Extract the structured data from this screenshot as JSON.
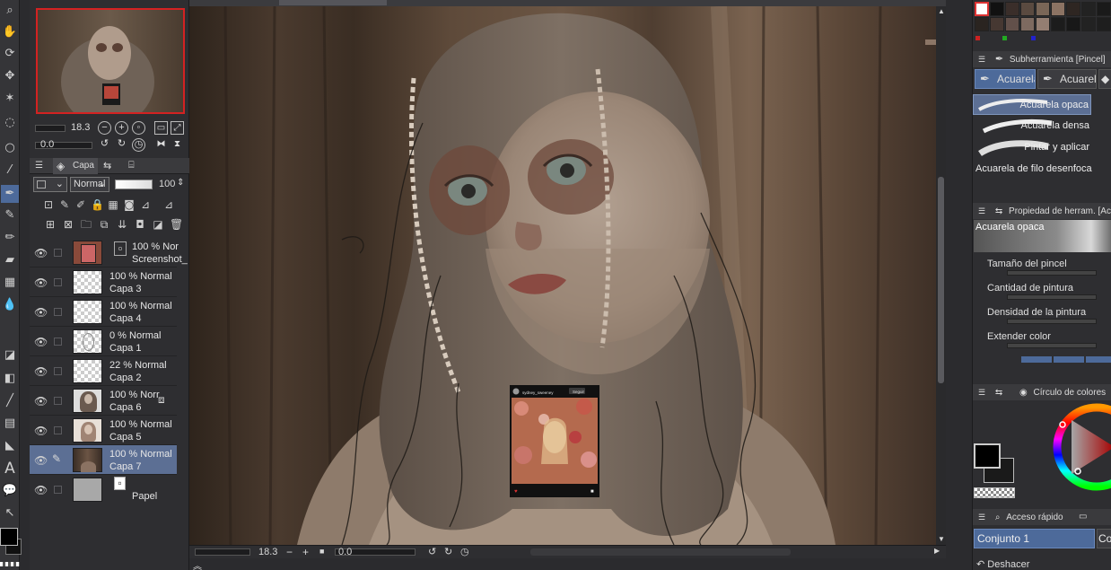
{
  "navigator": {
    "zoom": "18.3",
    "rotation": "0.0"
  },
  "layer_panel": {
    "tab_label": "Capa",
    "blend_mode": "Normal",
    "opacity": "100"
  },
  "layers": [
    {
      "pct": "100 % Nor",
      "name": "Screenshot_",
      "kind": "image",
      "visible": true
    },
    {
      "pct": "100 % Normal",
      "name": "Capa 3",
      "kind": "transparent",
      "visible": true
    },
    {
      "pct": "100 % Normal",
      "name": "Capa 4",
      "kind": "transparent",
      "visible": true
    },
    {
      "pct": "0 % Normal",
      "name": "Capa 1",
      "kind": "sketch",
      "visible": true
    },
    {
      "pct": "22 % Normal",
      "name": "Capa 2",
      "kind": "transparent",
      "visible": true
    },
    {
      "pct": "100 % Norr",
      "name": "Capa 6",
      "kind": "portrait",
      "visible": true
    },
    {
      "pct": "100 % Normal",
      "name": "Capa 5",
      "kind": "portrait-light",
      "visible": true
    },
    {
      "pct": "100 % Normal",
      "name": "Capa 7",
      "kind": "dark",
      "visible": true,
      "selected": true
    },
    {
      "pct": "",
      "name": "Papel",
      "kind": "paper",
      "visible": true
    }
  ],
  "status_bar": {
    "zoom": "18.3",
    "rotation": "0.0"
  },
  "palette_colors": [
    "#111111",
    "#3a2e2a",
    "#5a4a40",
    "#7a6657",
    "#8c7363",
    "#a08878",
    "#b49c8c",
    "#c8b2a2",
    "#dccabe",
    "#eee2da",
    "#f5efe9",
    "#2a2420",
    "#463832",
    "#62504a",
    "#7d6a60",
    "#947e72",
    "#a99284",
    "#bda696",
    "#d0bcae",
    "#e0d2c6",
    "#ece4dc",
    "#f8f4f0"
  ],
  "subtool_panel": {
    "header": "Subherramienta [Pincel]",
    "tabs": [
      "Acuarela",
      "Acuarela"
    ],
    "brushes": [
      "Acuarela opaca",
      "Acuarela densa",
      "Pintar y aplicar",
      "Acuarela de filo desenfoca"
    ]
  },
  "tool_property": {
    "header": "Propiedad de herram. [Ac",
    "brush_name": "Acuarela opaca",
    "props": [
      "Tamaño del pincel",
      "Cantidad de pintura",
      "Densidad de la pintura",
      "Extender color"
    ]
  },
  "color_wheel": {
    "header": "Círculo de colores",
    "main_color": "#000000",
    "sub_color": "#1a1a1a"
  },
  "quick_access": {
    "header": "Acceso rápido",
    "items": [
      "Conjunto 1",
      "Co"
    ],
    "undo_label": "Deshacer"
  },
  "embedded_post": {
    "username": "sydney_sweeney",
    "follow_label": "Seguir"
  }
}
